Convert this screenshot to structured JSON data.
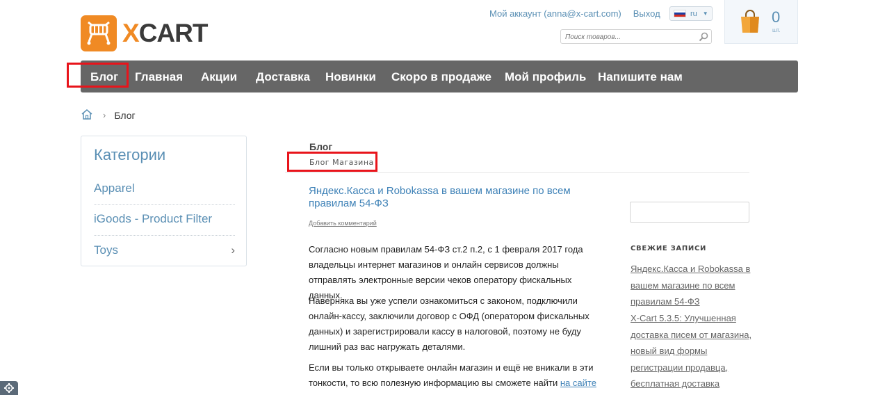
{
  "logo": {
    "text_x": "X",
    "text_rest": "CART"
  },
  "header": {
    "account_link": "Мой аккаунт (anna@x-cart.com)",
    "logout_link": "Выход",
    "language": "ru",
    "search_placeholder": "Поиск товаров...",
    "cart_count": "0",
    "cart_unit": "шт."
  },
  "nav": {
    "items": [
      "Блог",
      "Главная",
      "Акции",
      "Доставка",
      "Новинки",
      "Скоро в продаже",
      "Мой профиль",
      "Напишите нам"
    ]
  },
  "breadcrumb": {
    "separator": "›",
    "current": "Блог"
  },
  "sidebar": {
    "title": "Категории",
    "categories": [
      "Apparel",
      "iGoods - Product Filter",
      "Toys"
    ],
    "toys_chevron": "›"
  },
  "main": {
    "title": "Блог",
    "subtitle": "Блог Магазина",
    "post": {
      "title": "Яндекс.Касса и Robokassa в вашем магазине по всем правилам 54-ФЗ",
      "comment_link": "Добавить комментарий",
      "paragraphs": [
        "Согласно новым правилам 54-ФЗ ст.2 п.2, с 1 февраля 2017 года владельцы интернет магазинов и онлайн сервисов должны отправлять электронные версии чеков оператору фискальных данных.",
        "Наверняка вы уже успели ознакомиться с законом, подключили онлайн-кассу, заключили договор с ОФД (оператором фискальных данных) и зарегистрировали кассу в налоговой, поэтому не буду лишний раз вас нагружать деталями."
      ],
      "p3_text": "Если вы только открываете онлайн магазин и ещё не вникали в эти тонкости, то всю полезную информацию вы сможете найти ",
      "p3_link": "на сайте"
    }
  },
  "right": {
    "recent_title": "СВЕЖИЕ ЗАПИСИ",
    "recent_posts": [
      "Яндекс.Касса и Robokassa в вашем магазине по всем правилам 54-ФЗ",
      "X-Cart 5.3.5: Улучшенная доставка писем от магазина, новый вид формы регистрации продавца, бесплатная доставка"
    ]
  },
  "colors": {
    "accent": "#f08a24",
    "link": "#3f82b7",
    "nav_bg": "#666666",
    "highlight": "#e8141b"
  }
}
